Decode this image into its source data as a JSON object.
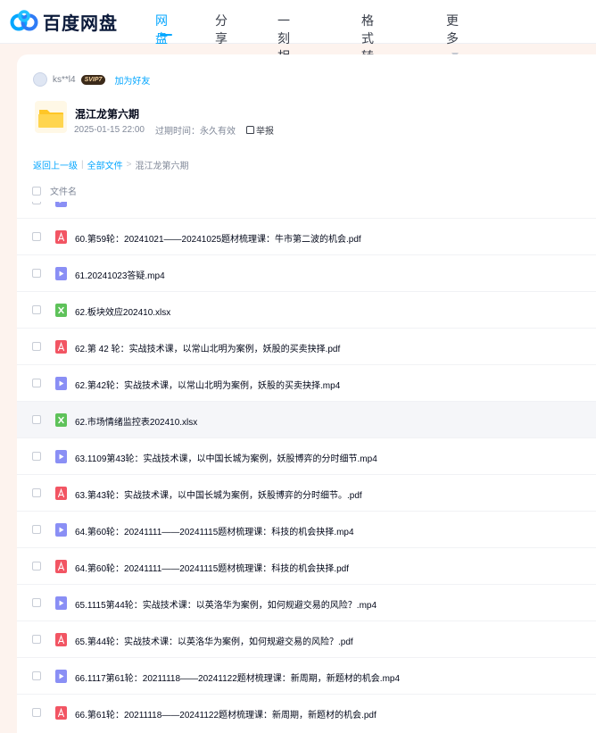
{
  "brand": {
    "name": "百度网盘"
  },
  "nav": [
    {
      "label": "网盘",
      "active": true
    },
    {
      "label": "分享",
      "active": false
    },
    {
      "label": "一刻相册",
      "active": false
    },
    {
      "label": "格式转换",
      "active": false
    },
    {
      "label": "更多",
      "active": false
    }
  ],
  "sharer": {
    "name": "ks**l4",
    "badge": "SVIP7",
    "add_friend": "加为好友"
  },
  "share": {
    "title": "混江龙第六期",
    "date": "2025-01-15 22:00",
    "expiry": "过期时间：永久有效",
    "report": "举报"
  },
  "breadcrumb": {
    "back": "返回上一级",
    "all": "全部文件",
    "sep": ">",
    "current": "混江龙第六期"
  },
  "list_header": {
    "name": "文件名"
  },
  "files": [
    {
      "type": "video",
      "name": ""
    },
    {
      "type": "pdf",
      "name": "60.第59轮：20241021——20241025题材梳理课：牛市第二波的机会.pdf"
    },
    {
      "type": "video",
      "name": "61.20241023答疑.mp4"
    },
    {
      "type": "excel",
      "name": "62.板块效应202410.xlsx"
    },
    {
      "type": "pdf",
      "name": "62.第 42 轮：实战技术课，以常山北明为案例，妖股的买卖抉择.pdf"
    },
    {
      "type": "video",
      "name": "62.第42轮：实战技术课，以常山北明为案例，妖股的买卖抉择.mp4"
    },
    {
      "type": "excel",
      "name": "62.市场情绪监控表202410.xlsx",
      "highlight": true
    },
    {
      "type": "video",
      "name": "63.1109第43轮：实战技术课，以中国长城为案例，妖股博弈的分时细节.mp4"
    },
    {
      "type": "pdf",
      "name": "63.第43轮：实战技术课，以中国长城为案例，妖股博弈的分时细节。.pdf"
    },
    {
      "type": "video",
      "name": "64.第60轮：20241111——20241115题材梳理课：科技的机会抉择.mp4"
    },
    {
      "type": "pdf",
      "name": "64.第60轮：20241111——20241115题材梳理课：科技的机会抉择.pdf"
    },
    {
      "type": "video",
      "name": "65.1115第44轮：实战技术课：以英洛华为案例，如何规避交易的风险？.mp4"
    },
    {
      "type": "pdf",
      "name": "65.第44轮：实战技术课：以英洛华为案例，如何规避交易的风险？.pdf"
    },
    {
      "type": "video",
      "name": "66.1117第61轮：20211118——20241122题材梳理课：新周期，新题材的机会.mp4"
    },
    {
      "type": "pdf",
      "name": "66.第61轮：20211118——20241122题材梳理课：新周期，新题材的机会.pdf"
    }
  ],
  "colors": {
    "accent": "#06a7ff",
    "pdf": "#f25563",
    "video": "#8a8ff5",
    "excel": "#5ec25a",
    "folder": "#ffc626"
  }
}
